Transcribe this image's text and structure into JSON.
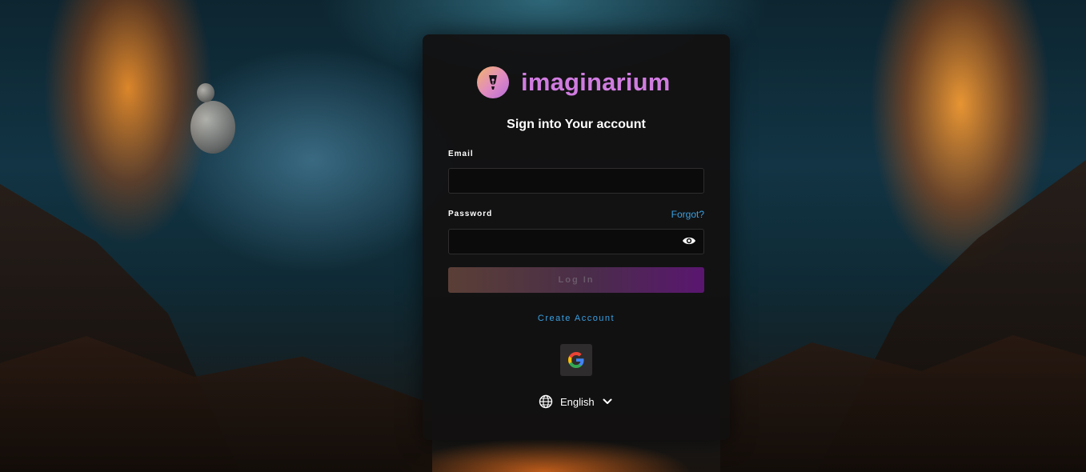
{
  "brand": {
    "name": "imaginarium",
    "color": "#d07ce0"
  },
  "form": {
    "heading": "Sign into Your account",
    "email_label": "Email",
    "email_value": "",
    "password_label": "Password",
    "password_value": "",
    "forgot_label": "Forgot?",
    "login_label": "Log In",
    "create_account_label": "Create Account"
  },
  "social": {
    "google_icon": "google-g-icon"
  },
  "language": {
    "selected": "English",
    "icon": "globe-icon"
  },
  "colors": {
    "link": "#3aa0e0",
    "card": "#121010"
  }
}
